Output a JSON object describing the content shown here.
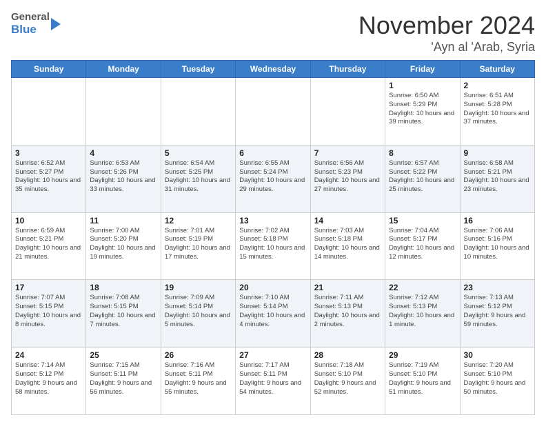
{
  "header": {
    "logo_general": "General",
    "logo_blue": "Blue",
    "month": "November 2024",
    "location": "'Ayn al 'Arab, Syria"
  },
  "weekdays": [
    "Sunday",
    "Monday",
    "Tuesday",
    "Wednesday",
    "Thursday",
    "Friday",
    "Saturday"
  ],
  "weeks": [
    [
      {
        "day": "",
        "text": ""
      },
      {
        "day": "",
        "text": ""
      },
      {
        "day": "",
        "text": ""
      },
      {
        "day": "",
        "text": ""
      },
      {
        "day": "",
        "text": ""
      },
      {
        "day": "1",
        "text": "Sunrise: 6:50 AM\nSunset: 5:29 PM\nDaylight: 10 hours\nand 39 minutes."
      },
      {
        "day": "2",
        "text": "Sunrise: 6:51 AM\nSunset: 5:28 PM\nDaylight: 10 hours\nand 37 minutes."
      }
    ],
    [
      {
        "day": "3",
        "text": "Sunrise: 6:52 AM\nSunset: 5:27 PM\nDaylight: 10 hours\nand 35 minutes."
      },
      {
        "day": "4",
        "text": "Sunrise: 6:53 AM\nSunset: 5:26 PM\nDaylight: 10 hours\nand 33 minutes."
      },
      {
        "day": "5",
        "text": "Sunrise: 6:54 AM\nSunset: 5:25 PM\nDaylight: 10 hours\nand 31 minutes."
      },
      {
        "day": "6",
        "text": "Sunrise: 6:55 AM\nSunset: 5:24 PM\nDaylight: 10 hours\nand 29 minutes."
      },
      {
        "day": "7",
        "text": "Sunrise: 6:56 AM\nSunset: 5:23 PM\nDaylight: 10 hours\nand 27 minutes."
      },
      {
        "day": "8",
        "text": "Sunrise: 6:57 AM\nSunset: 5:22 PM\nDaylight: 10 hours\nand 25 minutes."
      },
      {
        "day": "9",
        "text": "Sunrise: 6:58 AM\nSunset: 5:21 PM\nDaylight: 10 hours\nand 23 minutes."
      }
    ],
    [
      {
        "day": "10",
        "text": "Sunrise: 6:59 AM\nSunset: 5:21 PM\nDaylight: 10 hours\nand 21 minutes."
      },
      {
        "day": "11",
        "text": "Sunrise: 7:00 AM\nSunset: 5:20 PM\nDaylight: 10 hours\nand 19 minutes."
      },
      {
        "day": "12",
        "text": "Sunrise: 7:01 AM\nSunset: 5:19 PM\nDaylight: 10 hours\nand 17 minutes."
      },
      {
        "day": "13",
        "text": "Sunrise: 7:02 AM\nSunset: 5:18 PM\nDaylight: 10 hours\nand 15 minutes."
      },
      {
        "day": "14",
        "text": "Sunrise: 7:03 AM\nSunset: 5:18 PM\nDaylight: 10 hours\nand 14 minutes."
      },
      {
        "day": "15",
        "text": "Sunrise: 7:04 AM\nSunset: 5:17 PM\nDaylight: 10 hours\nand 12 minutes."
      },
      {
        "day": "16",
        "text": "Sunrise: 7:06 AM\nSunset: 5:16 PM\nDaylight: 10 hours\nand 10 minutes."
      }
    ],
    [
      {
        "day": "17",
        "text": "Sunrise: 7:07 AM\nSunset: 5:15 PM\nDaylight: 10 hours\nand 8 minutes."
      },
      {
        "day": "18",
        "text": "Sunrise: 7:08 AM\nSunset: 5:15 PM\nDaylight: 10 hours\nand 7 minutes."
      },
      {
        "day": "19",
        "text": "Sunrise: 7:09 AM\nSunset: 5:14 PM\nDaylight: 10 hours\nand 5 minutes."
      },
      {
        "day": "20",
        "text": "Sunrise: 7:10 AM\nSunset: 5:14 PM\nDaylight: 10 hours\nand 4 minutes."
      },
      {
        "day": "21",
        "text": "Sunrise: 7:11 AM\nSunset: 5:13 PM\nDaylight: 10 hours\nand 2 minutes."
      },
      {
        "day": "22",
        "text": "Sunrise: 7:12 AM\nSunset: 5:13 PM\nDaylight: 10 hours\nand 1 minute."
      },
      {
        "day": "23",
        "text": "Sunrise: 7:13 AM\nSunset: 5:12 PM\nDaylight: 9 hours\nand 59 minutes."
      }
    ],
    [
      {
        "day": "24",
        "text": "Sunrise: 7:14 AM\nSunset: 5:12 PM\nDaylight: 9 hours\nand 58 minutes."
      },
      {
        "day": "25",
        "text": "Sunrise: 7:15 AM\nSunset: 5:11 PM\nDaylight: 9 hours\nand 56 minutes."
      },
      {
        "day": "26",
        "text": "Sunrise: 7:16 AM\nSunset: 5:11 PM\nDaylight: 9 hours\nand 55 minutes."
      },
      {
        "day": "27",
        "text": "Sunrise: 7:17 AM\nSunset: 5:11 PM\nDaylight: 9 hours\nand 54 minutes."
      },
      {
        "day": "28",
        "text": "Sunrise: 7:18 AM\nSunset: 5:10 PM\nDaylight: 9 hours\nand 52 minutes."
      },
      {
        "day": "29",
        "text": "Sunrise: 7:19 AM\nSunset: 5:10 PM\nDaylight: 9 hours\nand 51 minutes."
      },
      {
        "day": "30",
        "text": "Sunrise: 7:20 AM\nSunset: 5:10 PM\nDaylight: 9 hours\nand 50 minutes."
      }
    ]
  ]
}
